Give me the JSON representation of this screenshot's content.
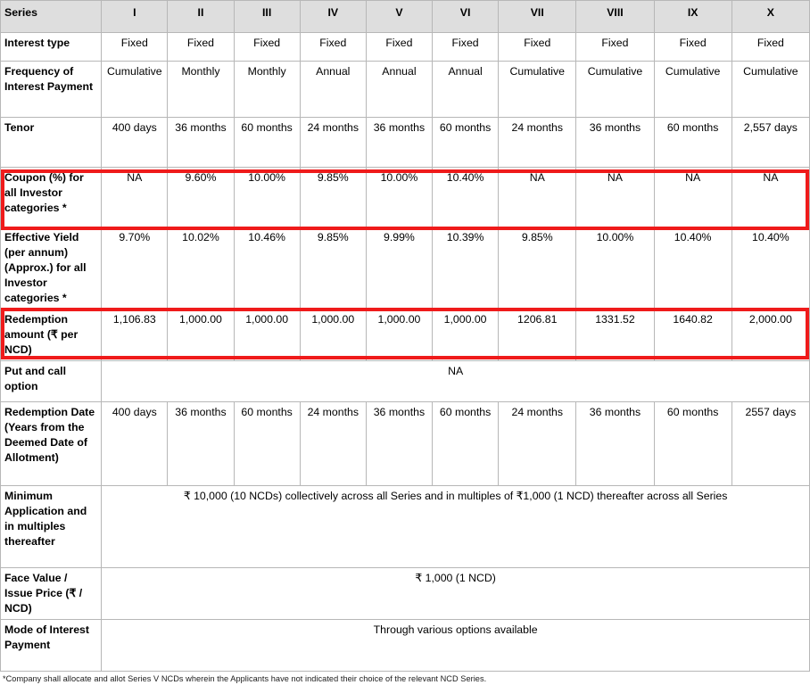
{
  "table": {
    "header": {
      "label": "Series",
      "series": [
        "I",
        "II",
        "III",
        "IV",
        "V",
        "VI",
        "VII",
        "VIII",
        "IX",
        "X"
      ]
    },
    "rows": [
      {
        "label": "Interest type",
        "type": "cells",
        "values": [
          "Fixed",
          "Fixed",
          "Fixed",
          "Fixed",
          "Fixed",
          "Fixed",
          "Fixed",
          "Fixed",
          "Fixed",
          "Fixed"
        ]
      },
      {
        "label": "Frequency of Interest Payment",
        "type": "cells",
        "values": [
          "Cumulative",
          "Monthly",
          "Monthly",
          "Annual",
          "Annual",
          "Annual",
          "Cumulative",
          "Cumulative",
          "Cumulative",
          "Cumulative"
        ]
      },
      {
        "label": "Tenor",
        "type": "cells",
        "values": [
          "400 days",
          "36 months",
          "60 months",
          "24 months",
          "36 months",
          "60 months",
          "24 months",
          "36 months",
          "60 months",
          "2,557 days"
        ]
      },
      {
        "label": "Coupon (%) for all Investor categories *",
        "type": "cells",
        "highlight": true,
        "values": [
          "NA",
          "9.60%",
          "10.00%",
          "9.85%",
          "10.00%",
          "10.40%",
          "NA",
          "NA",
          "NA",
          "NA"
        ]
      },
      {
        "label": "Effective Yield (per annum) (Approx.) for all Investor categories *",
        "type": "cells",
        "values": [
          "9.70%",
          "10.02%",
          "10.46%",
          "9.85%",
          "9.99%",
          "10.39%",
          "9.85%",
          "10.00%",
          "10.40%",
          "10.40%"
        ]
      },
      {
        "label": "Redemption amount (₹ per NCD)",
        "type": "cells",
        "highlight": true,
        "values": [
          "1,106.83",
          "1,000.00",
          "1,000.00",
          "1,000.00",
          "1,000.00",
          "1,000.00",
          "1206.81",
          "1331.52",
          "1640.82",
          "2,000.00"
        ]
      },
      {
        "label": "Put and call option",
        "type": "merged",
        "merged_value": "NA"
      },
      {
        "label": "Redemption Date (Years from the Deemed Date of Allotment)",
        "type": "cells",
        "values": [
          "400 days",
          "36 months",
          "60 months",
          "24 months",
          "36 months",
          "60 months",
          "24 months",
          "36 months",
          "60 months",
          "2557 days"
        ]
      },
      {
        "label": "Minimum Application and in multiples thereafter",
        "type": "merged",
        "merged_value": "₹ 10,000 (10 NCDs) collectively across all Series and in multiples of ₹1,000 (1 NCD) thereafter across all Series"
      },
      {
        "label": "Face Value / Issue Price (₹ / NCD)",
        "type": "merged",
        "merged_value": "₹ 1,000 (1 NCD)"
      },
      {
        "label": "Mode of Interest Payment",
        "type": "merged",
        "merged_value": "Through various options available"
      }
    ]
  },
  "footnote": "*Company shall allocate and allot Series V NCDs wherein the Applicants have not indicated their choice of the relevant NCD Series.",
  "colors": {
    "header_background": "#dedede",
    "highlight_border": "#ef1b1b",
    "grid_line": "#b7b7b7",
    "text": "#000000"
  }
}
